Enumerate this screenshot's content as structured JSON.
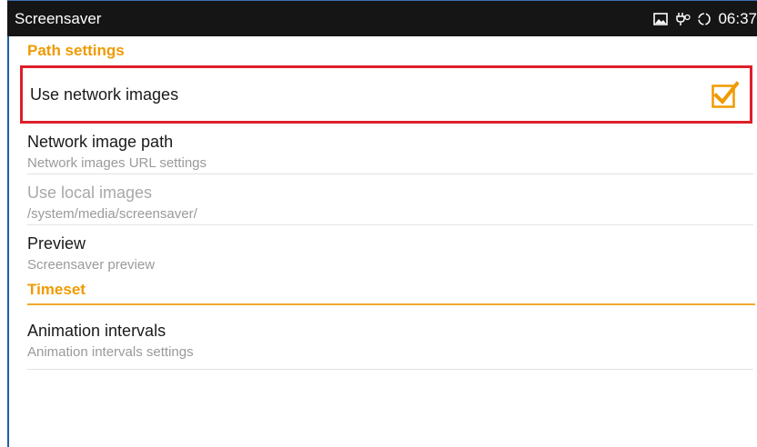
{
  "status_bar": {
    "title": "Screensaver",
    "time": "06:37",
    "icons": [
      "image-icon",
      "usb-debug-icon",
      "sync-icon"
    ]
  },
  "sections": [
    {
      "header": "Path settings",
      "items": [
        {
          "title": "Use network images",
          "checked": true,
          "highlighted": true
        },
        {
          "title": "Network image path",
          "summary": "Network images URL settings"
        },
        {
          "title": "Use local images",
          "summary": "/system/media/screensaver/",
          "disabled": true
        },
        {
          "title": "Preview",
          "summary": "Screensaver preview"
        }
      ]
    },
    {
      "header": "Timeset",
      "items": [
        {
          "title": "Animation intervals",
          "summary": "Animation intervals settings"
        }
      ]
    }
  ],
  "colors": {
    "accent": "#f09a00",
    "highlight_border": "#dd1f2a",
    "status_bar_bg": "#151515"
  }
}
